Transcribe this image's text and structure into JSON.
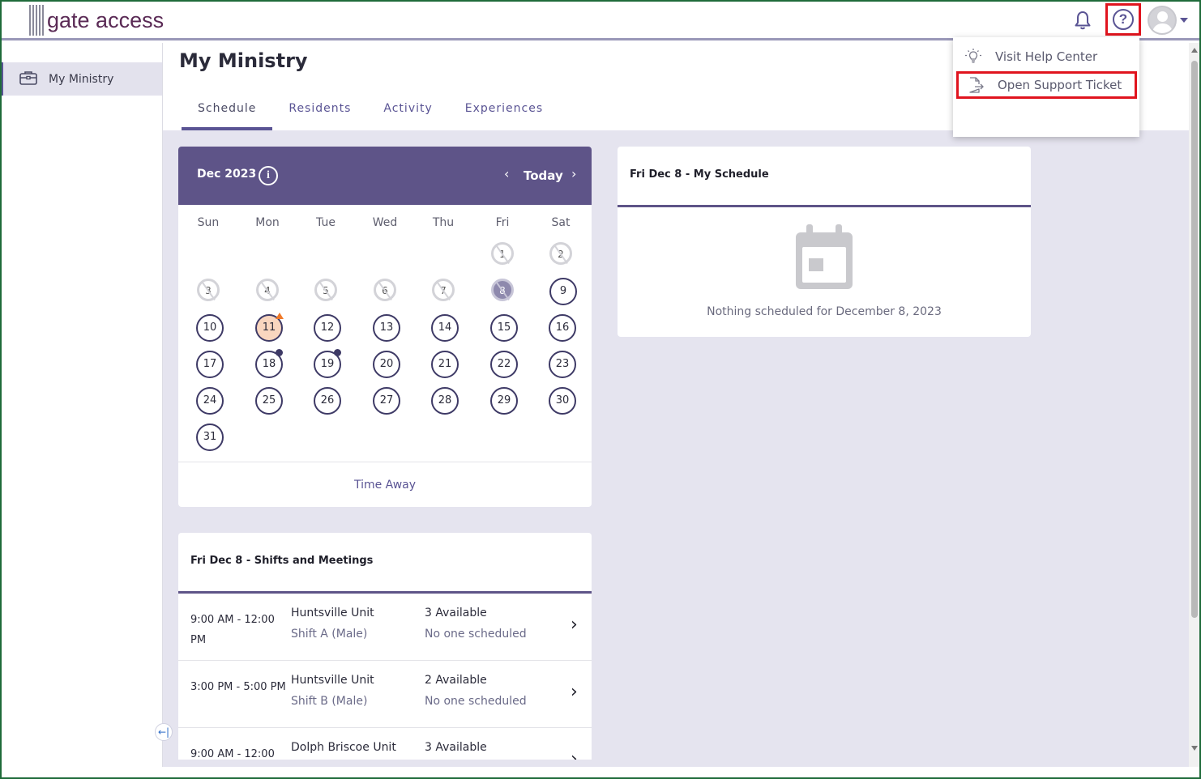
{
  "app": {
    "logo_text": "gate access"
  },
  "sidebar": {
    "items": [
      {
        "label": "My Ministry",
        "icon": "briefcase-icon"
      }
    ]
  },
  "page": {
    "title": "My Ministry",
    "tabs": [
      {
        "label": "Schedule",
        "active": true
      },
      {
        "label": "Residents"
      },
      {
        "label": "Activity"
      },
      {
        "label": "Experiences"
      }
    ]
  },
  "calendar": {
    "month": "Dec 2023",
    "today_label": "Today",
    "weekdays": [
      "Sun",
      "Mon",
      "Tue",
      "Wed",
      "Thu",
      "Fri",
      "Sat"
    ],
    "footer": "Time Away"
  },
  "schedule": {
    "title": "Fri Dec 8 - My Schedule",
    "empty": "Nothing scheduled for December 8, 2023"
  },
  "shifts": {
    "title": "Fri Dec 8 - Shifts and Meetings",
    "rows": [
      {
        "time": "9:00 AM - 12:00 PM",
        "unit": "Huntsville Unit",
        "shift": "Shift A (Male)",
        "available": "3 Available",
        "scheduled": "No one scheduled"
      },
      {
        "time": "3:00 PM - 5:00 PM",
        "unit": "Huntsville Unit",
        "shift": "Shift B (Male)",
        "available": "2 Available",
        "scheduled": "No one scheduled"
      },
      {
        "time": "9:00 AM - 12:00",
        "unit": "Dolph Briscoe Unit",
        "shift": "",
        "available": "3 Available",
        "scheduled": ""
      }
    ]
  },
  "help_menu": {
    "items": [
      {
        "label": "Visit Help Center",
        "icon": "lightbulb-icon"
      },
      {
        "label": "Open Support Ticket",
        "icon": "ticket-export-icon"
      }
    ]
  },
  "colors": {
    "accent": "#5e5488",
    "highlight": "#e0141e",
    "background": "#e5e4ef"
  }
}
